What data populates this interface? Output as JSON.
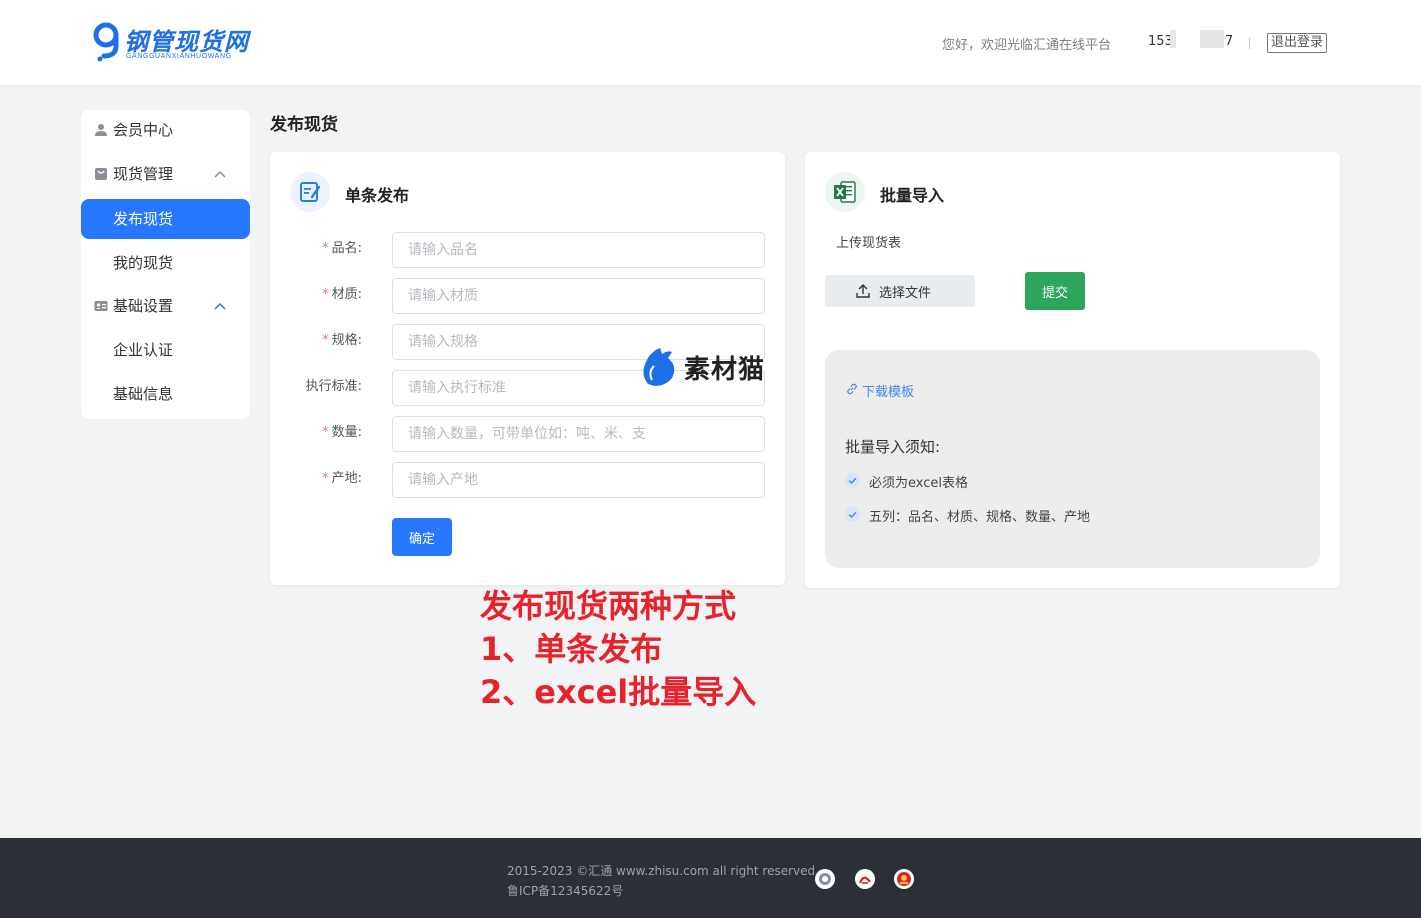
{
  "header": {
    "logo_text": "钢管现货网",
    "logo_sub": "GANGGUANXIANHUOWANG",
    "greeting": "您好，欢迎光临汇通在线平台",
    "phone_prefix": "153",
    "phone_suffix": "7",
    "logout_label": "退出登录"
  },
  "sidebar": {
    "member_center": "会员中心",
    "goods_management": "现货管理",
    "publish_goods": "发布现货",
    "my_goods": "我的现货",
    "basic_settings": "基础设置",
    "enterprise_auth": "企业认证",
    "basic_info": "基础信息"
  },
  "page_title": "发布现货",
  "single": {
    "title": "单条发布",
    "fields": [
      {
        "label": "品名:",
        "required": true,
        "placeholder": "请输入品名"
      },
      {
        "label": "材质:",
        "required": true,
        "placeholder": "请输入材质"
      },
      {
        "label": "规格:",
        "required": true,
        "placeholder": "请输入规格"
      },
      {
        "label": "执行标准:",
        "required": false,
        "placeholder": "请输入执行标准"
      },
      {
        "label": "数量:",
        "required": true,
        "placeholder": "请输入数量，可带单位如：吨、米、支"
      },
      {
        "label": "产地:",
        "required": true,
        "placeholder": "请输入产地"
      }
    ],
    "confirm_label": "确定"
  },
  "batch": {
    "title": "批量导入",
    "upload_label": "上传现货表",
    "choose_file_label": "选择文件",
    "submit_label": "提交",
    "download_template": "下载模板",
    "notice_title": "批量导入须知:",
    "rules": [
      "必须为excel表格",
      "五列：品名、材质、规格、数量、产地"
    ]
  },
  "annotation": [
    "发布现货两种方式",
    "1、单条发布",
    "2、excel批量导入"
  ],
  "watermark": "素材猫",
  "footer": {
    "copyright": "2015-2023 ©汇通 www.zhisu.com all right reserved",
    "icp": "鲁ICP备12345622号"
  },
  "colors": {
    "primary": "#2878ff",
    "success": "#2ea55d",
    "required": "#f56c6c",
    "annotation": "#e8212b",
    "footer_bg": "#2b2f36"
  }
}
